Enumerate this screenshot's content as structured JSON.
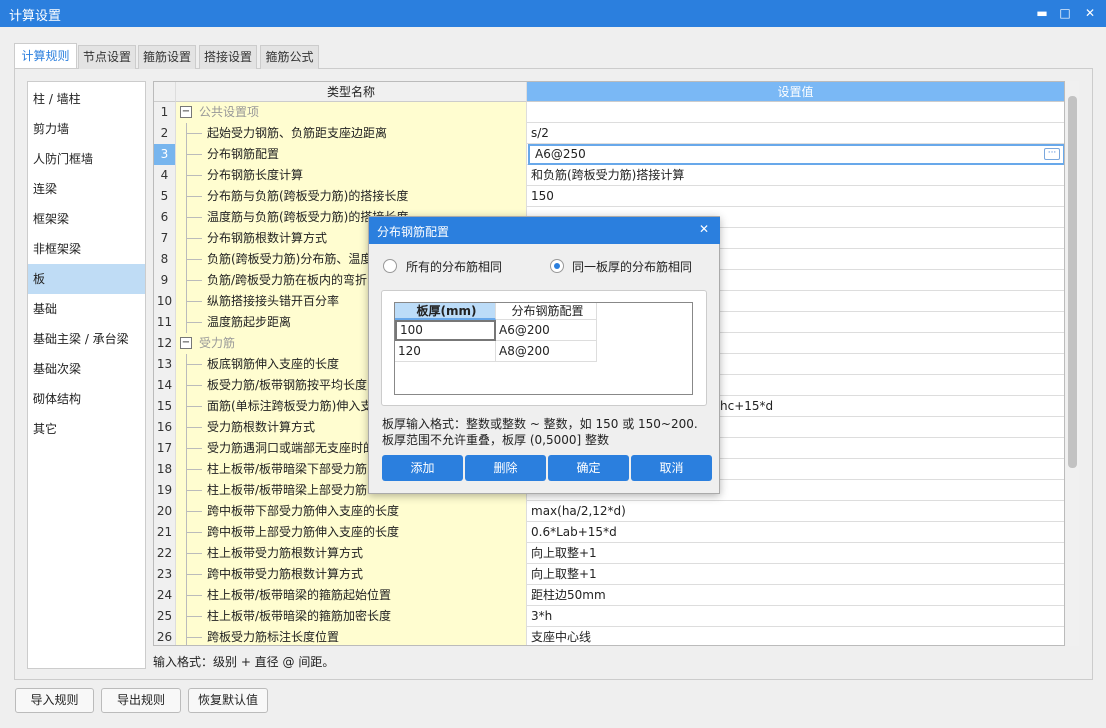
{
  "window": {
    "title": "计算设置",
    "min": "▬",
    "max": "□",
    "close": "✕"
  },
  "tabs": [
    {
      "label": "计算规则",
      "active": true
    },
    {
      "label": "节点设置"
    },
    {
      "label": "箍筋设置"
    },
    {
      "label": "搭接设置"
    },
    {
      "label": "箍筋公式"
    }
  ],
  "sidebar": {
    "items": [
      {
        "label": "柱 / 墙柱"
      },
      {
        "label": "剪力墙"
      },
      {
        "label": "人防门框墙"
      },
      {
        "label": "连梁"
      },
      {
        "label": "框架梁"
      },
      {
        "label": "非框架梁"
      },
      {
        "label": "板",
        "selected": true
      },
      {
        "label": "基础"
      },
      {
        "label": "基础主梁 / 承台梁"
      },
      {
        "label": "基础次梁"
      },
      {
        "label": "砌体结构"
      },
      {
        "label": "其它"
      }
    ]
  },
  "grid": {
    "headers": {
      "name": "类型名称",
      "value": "设置值"
    },
    "rows": [
      {
        "n": "1",
        "name": "公共设置项",
        "group": true,
        "value": ""
      },
      {
        "n": "2",
        "name": "起始受力钢筋、负筋距支座边距离",
        "value": "s/2"
      },
      {
        "n": "3",
        "name": "分布钢筋配置",
        "value": "A6@250",
        "editing": true
      },
      {
        "n": "4",
        "name": "分布钢筋长度计算",
        "value": "和负筋(跨板受力筋)搭接计算"
      },
      {
        "n": "5",
        "name": "分布筋与负筋(跨板受力筋)的搭接长度",
        "value": "150"
      },
      {
        "n": "6",
        "name": "温度筋与负筋(跨板受力筋)的搭接长度",
        "value": ""
      },
      {
        "n": "7",
        "name": "分布钢筋根数计算方式",
        "value": ""
      },
      {
        "n": "8",
        "name": "负筋(跨板受力筋)分布筋、温度",
        "value": ""
      },
      {
        "n": "9",
        "name": "负筋/跨板受力筋在板内的弯折",
        "value": ""
      },
      {
        "n": "10",
        "name": "纵筋搭接接头错开百分率",
        "value": ""
      },
      {
        "n": "11",
        "name": "温度筋起步距离",
        "value": ""
      },
      {
        "n": "12",
        "name": "受力筋",
        "group": true,
        "value": ""
      },
      {
        "n": "13",
        "name": "板底钢筋伸入支座的长度",
        "value": ""
      },
      {
        "n": "14",
        "name": "板受力筋/板带钢筋按平均长度",
        "value": ""
      },
      {
        "n": "15",
        "name": "面筋(单标注跨板受力筋)伸入支",
        "value": "hc+15*d",
        "offset": true
      },
      {
        "n": "16",
        "name": "受力筋根数计算方式",
        "value": ""
      },
      {
        "n": "17",
        "name": "受力筋遇洞口或端部无支座时的",
        "value": ""
      },
      {
        "n": "18",
        "name": "柱上板带/板带暗梁下部受力筋",
        "value": ""
      },
      {
        "n": "19",
        "name": "柱上板带/板带暗梁上部受力筋",
        "value": ""
      },
      {
        "n": "20",
        "name": "跨中板带下部受力筋伸入支座的长度",
        "value": "max(ha/2,12*d)"
      },
      {
        "n": "21",
        "name": "跨中板带上部受力筋伸入支座的长度",
        "value": "0.6*Lab+15*d"
      },
      {
        "n": "22",
        "name": "柱上板带受力筋根数计算方式",
        "value": "向上取整+1"
      },
      {
        "n": "23",
        "name": "跨中板带受力筋根数计算方式",
        "value": "向上取整+1"
      },
      {
        "n": "24",
        "name": "柱上板带/板带暗梁的箍筋起始位置",
        "value": "距柱边50mm"
      },
      {
        "n": "25",
        "name": "柱上板带/板带暗梁的箍筋加密长度",
        "value": "3*h"
      },
      {
        "n": "26",
        "name": "跨板受力筋标注长度位置",
        "value": "支座中心线"
      }
    ]
  },
  "hint": "输入格式：级别 + 直径 @ 间距。",
  "footer": {
    "import": "导入规则",
    "export": "导出规则",
    "restore": "恢复默认值"
  },
  "dialog": {
    "title": "分布钢筋配置",
    "close": "✕",
    "radio_all": "所有的分布筋相同",
    "radio_thickness": "同一板厚的分布筋相同",
    "selected": "radio_thickness",
    "table": {
      "headers": [
        "板厚(mm)",
        "分布钢筋配置"
      ],
      "rows": [
        [
          "100",
          "A6@200"
        ],
        [
          "120",
          "A8@200"
        ]
      ]
    },
    "note1": "板厚输入格式：整数或整数 ~ 整数，如 150 或 150~200.",
    "note2": "板厚范围不允许重叠，板厚 (0,5000] 整数",
    "buttons": {
      "add": "添加",
      "delete": "删除",
      "ok": "确定",
      "cancel": "取消"
    }
  },
  "colors": {
    "accent": "#2b7fde",
    "name_bg": "#fffdd0",
    "selected": "#bfdcf5"
  }
}
